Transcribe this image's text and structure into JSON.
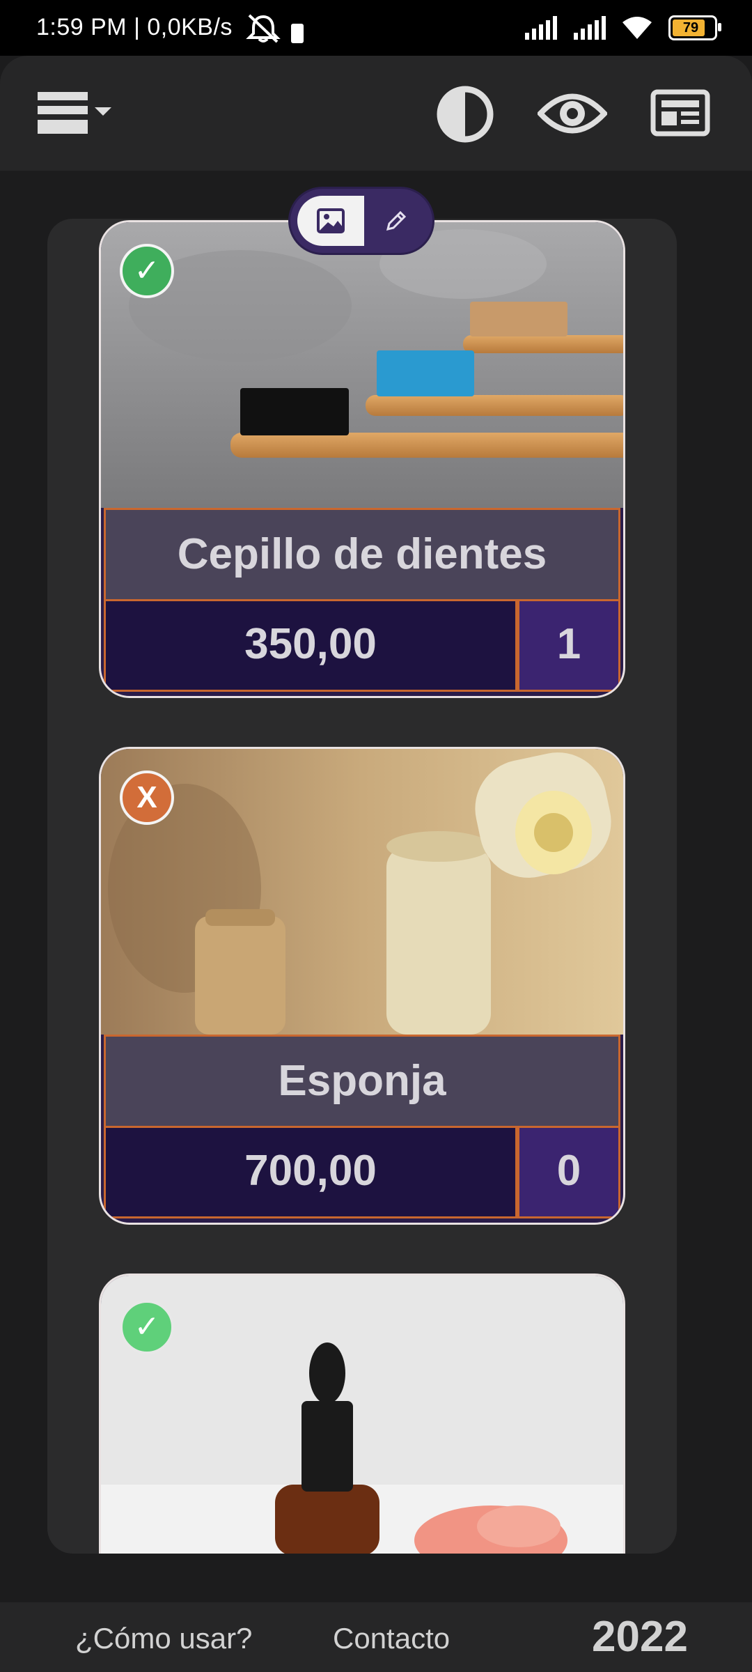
{
  "status_bar": {
    "time_net": "1:59 PM | 0,0KB/s",
    "battery_level": "79"
  },
  "app_bar": {
    "icons": [
      "menu-icon",
      "contrast-icon",
      "eye-icon",
      "news-icon"
    ]
  },
  "mode_toggle": {
    "selected": "image",
    "options": [
      "image-icon",
      "pencil-icon"
    ]
  },
  "products": [
    {
      "name": "Cepillo de dientes",
      "price": "350,00",
      "qty": "1",
      "status": "✓",
      "status_color": "#3fae5c"
    },
    {
      "name": "Esponja",
      "price": "700,00",
      "qty": "0",
      "status": "X",
      "status_color": "#d26d39"
    },
    {
      "name": "",
      "price": "",
      "qty": "",
      "status": "✓",
      "status_color": "#5fd07a"
    }
  ],
  "footer": {
    "how_to": "¿Cómo usar?",
    "contact": "Contacto",
    "year": "2022"
  },
  "colors": {
    "accent_border": "#c9672f",
    "price_bg": "#1d1240",
    "qty_bg": "#3b2470",
    "name_bg": "#4a4459",
    "toggle_bg": "#3a2a63"
  }
}
